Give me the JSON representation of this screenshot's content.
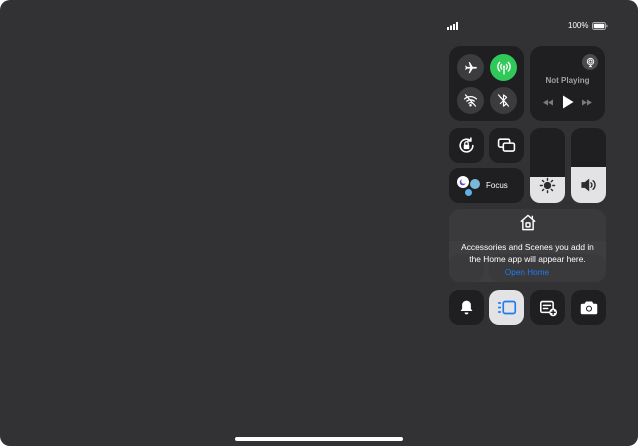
{
  "status_bar": {
    "battery_percent": "100%",
    "signal_icon": "cellular-bars-icon",
    "battery_icon": "battery-full-icon"
  },
  "connectivity": {
    "airplane_icon": "airplane-icon",
    "cellular_icon": "antenna-icon",
    "wifi_icon": "wifi-off-icon",
    "bluetooth_icon": "bluetooth-off-icon",
    "cellular_active_color": "#31C85A"
  },
  "now_playing": {
    "status": "Not Playing",
    "airplay_icon": "airplay-icon"
  },
  "focus": {
    "label": "Focus"
  },
  "sliders": {
    "brightness_level": 0.35,
    "volume_level": 0.48
  },
  "home": {
    "message": "Accessories and Scenes you add in the Home app will appear here.",
    "open_label": "Open Home",
    "link_color": "#1E7CF2"
  },
  "bottom_controls": [
    {
      "name": "silent-mode",
      "icon": "bell-icon"
    },
    {
      "name": "stage-manager",
      "icon": "stage-manager-icon",
      "active": true
    },
    {
      "name": "quick-note",
      "icon": "note-add-icon"
    },
    {
      "name": "camera",
      "icon": "camera-icon"
    }
  ]
}
